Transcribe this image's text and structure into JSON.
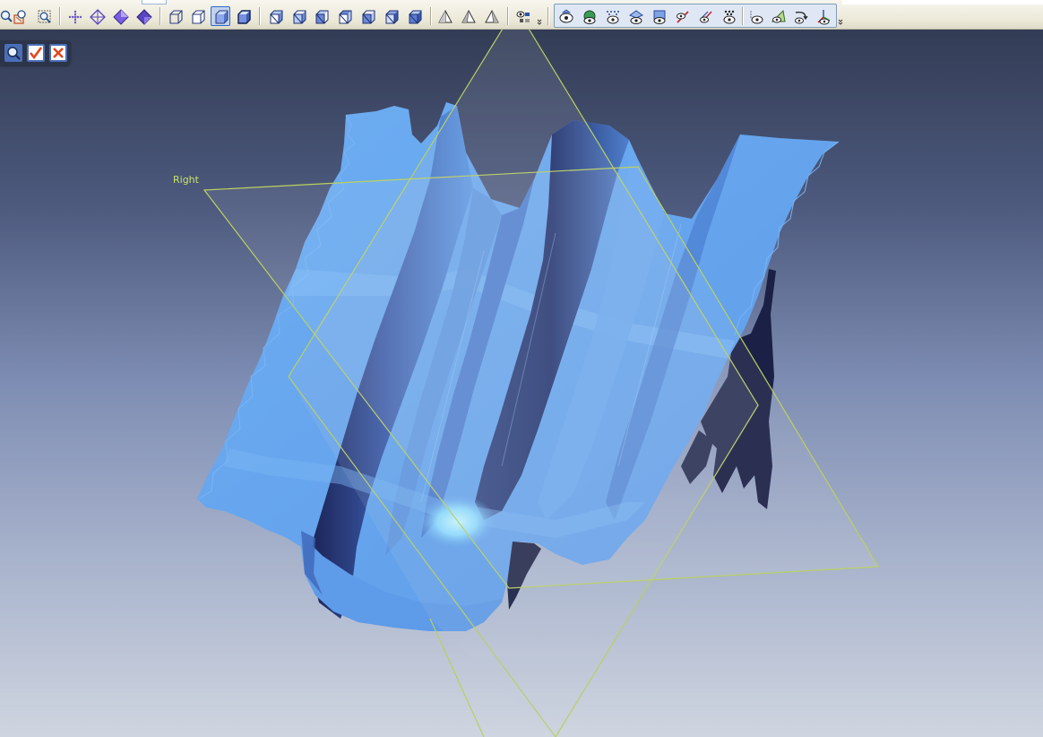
{
  "toolbar": {
    "view_group": [
      "zoom-icon",
      "fit-view-icon",
      "zoom-window-icon",
      "pan-icon",
      "orbit-icon",
      "view-front-icon",
      "view-back-icon"
    ],
    "display_group": [
      "wireframe-box-icon",
      "hidden-line-box-icon",
      "shaded-box-icon",
      "shaded-edges-box-icon"
    ],
    "std_views": [
      "iso-view-1-icon",
      "iso-view-2-icon",
      "iso-view-3-icon",
      "iso-view-4-icon",
      "iso-view-5-icon",
      "iso-view-6-icon"
    ],
    "triad_group": [
      "triad-1-icon",
      "triad-2-icon",
      "triad-3-icon"
    ],
    "pressed_display_mode": "shaded-box-icon"
  },
  "visibility_toolbar": {
    "items": [
      "show-mesh-icon",
      "show-colored-icon",
      "show-points-icon",
      "show-feature-icon",
      "show-plane-icon",
      "show-reference-icon",
      "show-annotation-icon",
      "show-vertices-icon",
      "show-eye-icon",
      "show-section-icon",
      "show-curve-icon",
      "show-axis-icon"
    ]
  },
  "mini_toolbar": {
    "items": [
      "search-icon",
      "accept-icon",
      "cancel-icon"
    ]
  },
  "viewport": {
    "plane_label": "Right",
    "background_top": "#333c55",
    "background_bottom": "#cfd5e0",
    "mesh_color": "#6aaaf0",
    "mesh_shadow_color": "#1d2a5c",
    "plane_outline_color": "#b8d05a",
    "highlight_color": "#b7f3ff"
  }
}
